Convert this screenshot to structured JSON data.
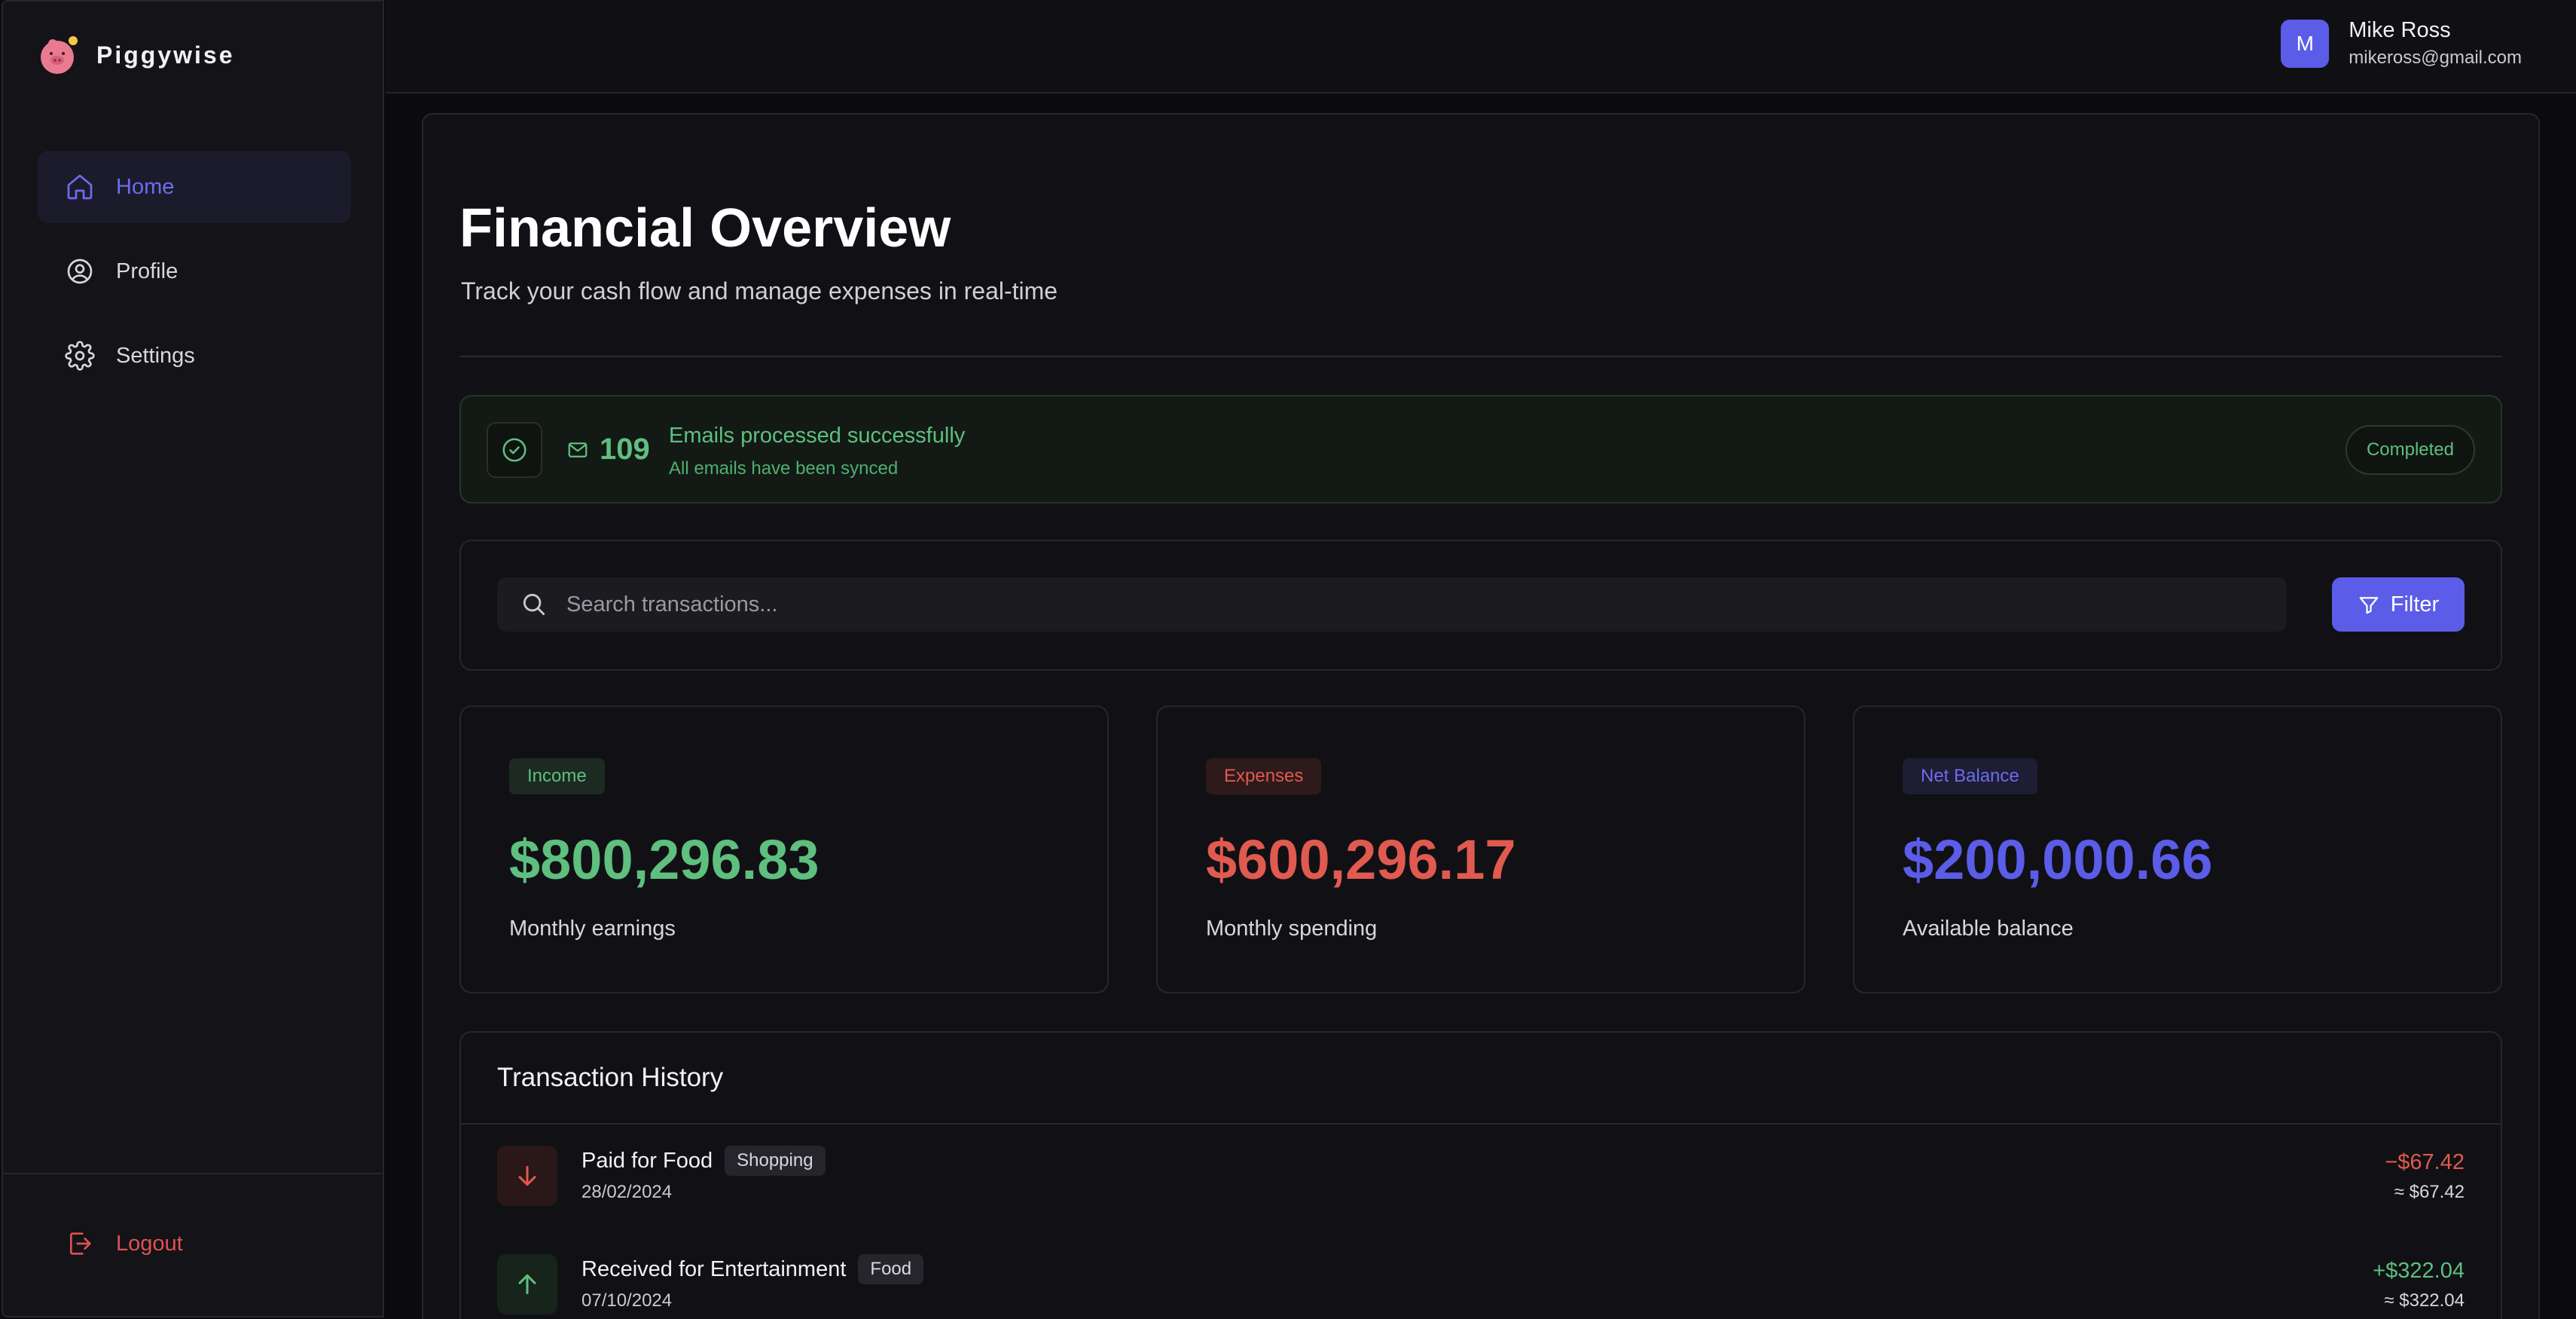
{
  "app": {
    "name": "Piggywise"
  },
  "sidebar": {
    "items": [
      {
        "label": "Home",
        "icon": "home-icon",
        "active": true
      },
      {
        "label": "Profile",
        "icon": "user-circle-icon",
        "active": false
      },
      {
        "label": "Settings",
        "icon": "gear-icon",
        "active": false
      }
    ],
    "logout_label": "Logout"
  },
  "user": {
    "initial": "M",
    "name": "Mike Ross",
    "email": "mikeross@gmail.com"
  },
  "header": {
    "title": "Financial Overview",
    "subtitle": "Track your cash flow and manage expenses in real-time"
  },
  "status": {
    "count": "109",
    "title": "Emails processed successfully",
    "subtitle": "All emails have been synced",
    "badge": "Completed"
  },
  "search": {
    "placeholder": "Search transactions...",
    "value": "",
    "filter_label": "Filter"
  },
  "stats": [
    {
      "label": "Income",
      "value": "$800,296.83",
      "description": "Monthly earnings",
      "color": "#5fbf7f"
    },
    {
      "label": "Expenses",
      "value": "$600,296.17",
      "description": "Monthly spending",
      "color": "#e05a4f"
    },
    {
      "label": "Net Balance",
      "value": "$200,000.66",
      "description": "Available balance",
      "color": "#5b5ce8"
    }
  ],
  "transactions": {
    "title": "Transaction History",
    "rows": [
      {
        "name": "Paid for Food",
        "tag": "Shopping",
        "date": "28/02/2024",
        "amount": "−$67.42",
        "approx": "≈ $67.42",
        "direction": "out"
      },
      {
        "name": "Received for Entertainment",
        "tag": "Food",
        "date": "07/10/2024",
        "amount": "+$322.04",
        "approx": "≈ $322.04",
        "direction": "in"
      }
    ]
  },
  "colors": {
    "accent": "#5b5ce8",
    "positive": "#5fbf7f",
    "negative": "#e05a4f",
    "background": "#111115"
  }
}
